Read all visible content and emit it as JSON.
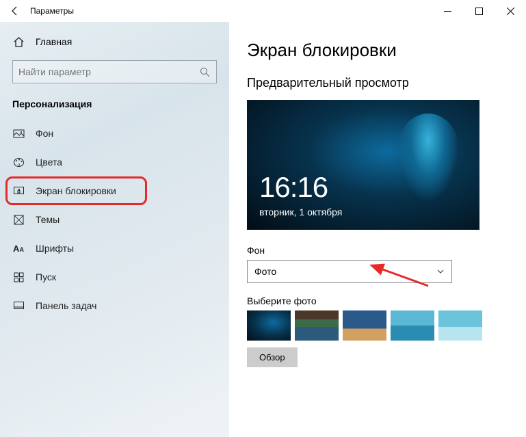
{
  "window": {
    "title": "Параметры"
  },
  "sidebar": {
    "home_label": "Главная",
    "search_placeholder": "Найти параметр",
    "section": "Персонализация",
    "items": [
      {
        "label": "Фон"
      },
      {
        "label": "Цвета"
      },
      {
        "label": "Экран блокировки"
      },
      {
        "label": "Темы"
      },
      {
        "label": "Шрифты"
      },
      {
        "label": "Пуск"
      },
      {
        "label": "Панель задач"
      }
    ]
  },
  "content": {
    "heading": "Экран блокировки",
    "preview_label": "Предварительный просмотр",
    "preview_time": "16:16",
    "preview_date": "вторник, 1 октября",
    "bg_label": "Фон",
    "bg_selected": "Фото",
    "choose_label": "Выберите фото",
    "browse_label": "Обзор"
  }
}
